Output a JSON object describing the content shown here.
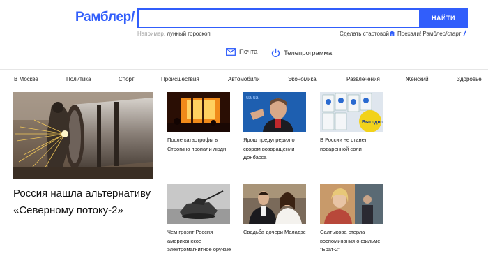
{
  "header": {
    "logo": "Рамблер/",
    "search": {
      "value": "",
      "placeholder": "",
      "button": "НАЙТИ"
    },
    "hint_prefix": "Например, ",
    "hint_example": "лунный гороскоп",
    "start_link": "Сделать стартовой",
    "poehali": "Поехали! Рамблер/старт"
  },
  "services": [
    {
      "label": "Почта",
      "icon": "mail-icon"
    },
    {
      "label": "Телепрограмма",
      "icon": "power-icon"
    }
  ],
  "nav": [
    "В Москве",
    "Политика",
    "Спорт",
    "Происшествия",
    "Автомобили",
    "Экономика",
    "Развлечения",
    "Женский",
    "Здоровье"
  ],
  "main_story": {
    "title": "Россия нашла альтернативу «Северному потоку-2»",
    "image": "welder-pipe-sparks"
  },
  "cards": [
    {
      "text": "После катастрофы в Строгино пропали люди",
      "image": "fire-night"
    },
    {
      "text": "Ярош предупредил о скором возвращении Донбасса",
      "image": "man-speaking"
    },
    {
      "text": "В России не станет поваренной соли",
      "image": "salt-packages"
    },
    {
      "text": "Чем грозит Россия американское электромагнитное оружие",
      "image": "tank-bw"
    },
    {
      "text": "Свадьба дочери Меладзе",
      "image": "wedding-couple"
    },
    {
      "text": "Салтыкова стерла воспоминания о фильме \"Брат-2\"",
      "image": "woman-film"
    }
  ],
  "colors": {
    "brand": "#315efb",
    "text": "#1a1a1a",
    "muted": "#9a9a9a"
  }
}
